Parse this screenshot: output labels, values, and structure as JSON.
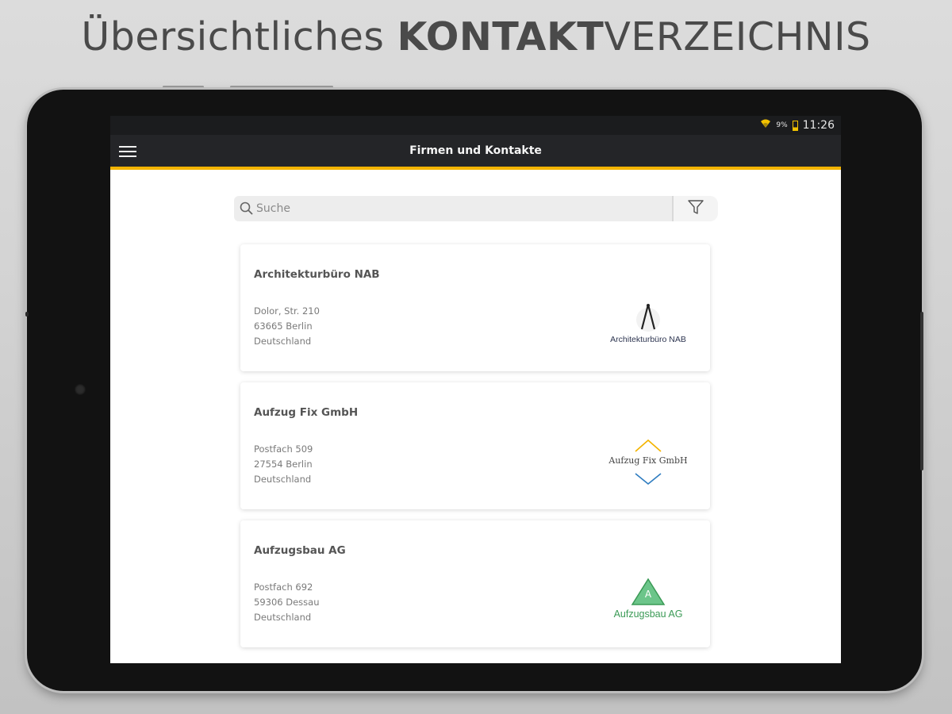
{
  "headline": {
    "regular": "Übersichtliches ",
    "bold": "KONTAKT",
    "rest": "VERZEICHNIS"
  },
  "statusbar": {
    "battery_pct": "9%",
    "time": "11:26"
  },
  "appbar": {
    "title": "Firmen und Kontakte"
  },
  "search": {
    "placeholder": "Suche",
    "value": ""
  },
  "accent_color": "#f4b400",
  "companies": [
    {
      "name": "Architekturbüro NAB",
      "street": "Dolor, Str. 210",
      "city": "63665 Berlin",
      "country": "Deutschland",
      "logo_text": "Architekturbüro NAB",
      "logo_icon": "compass-icon"
    },
    {
      "name": "Aufzug Fix GmbH",
      "street": "Postfach 509",
      "city": "27554 Berlin",
      "country": "Deutschland",
      "logo_text": "Aufzug Fix GmbH",
      "logo_icon": "chevrons-icon"
    },
    {
      "name": "Aufzugsbau AG",
      "street": "Postfach 692",
      "city": "59306 Dessau",
      "country": "Deutschland",
      "logo_text": "Aufzugsbau AG",
      "logo_letter": "A",
      "logo_icon": "triangle-icon",
      "logo_color": "#3a9a55"
    }
  ]
}
